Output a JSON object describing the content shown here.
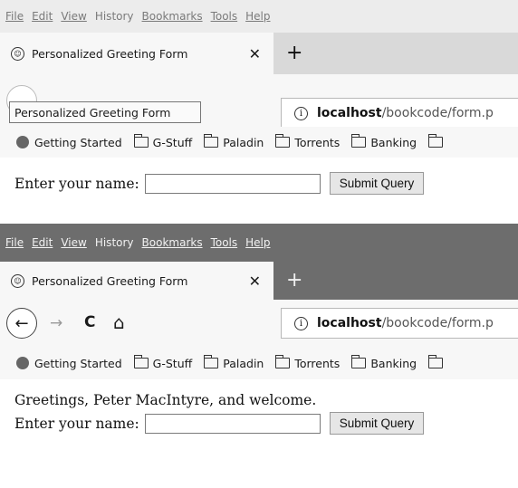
{
  "menus": [
    "File",
    "Edit",
    "View",
    "History",
    "Bookmarks",
    "Tools",
    "Help"
  ],
  "tab": {
    "title": "Personalized Greeting Form",
    "close_glyph": "✕",
    "new_tab_glyph": "+"
  },
  "tooltip": "Personalized Greeting Form",
  "nav": {
    "back_glyph": "←",
    "forward_glyph": "→",
    "reload_glyph": "C",
    "home_glyph": "⌂"
  },
  "url": {
    "host": "localhost",
    "path": "/bookcode/form.p",
    "info_glyph": "i"
  },
  "bookmarks": [
    "Getting Started",
    "G-Stuff",
    "Paladin",
    "Torrents",
    "Banking"
  ],
  "form": {
    "label": "Enter your name:",
    "value": "",
    "submit_label": "Submit Query"
  },
  "greeting": "Greetings, Peter MacIntyre, and welcome."
}
